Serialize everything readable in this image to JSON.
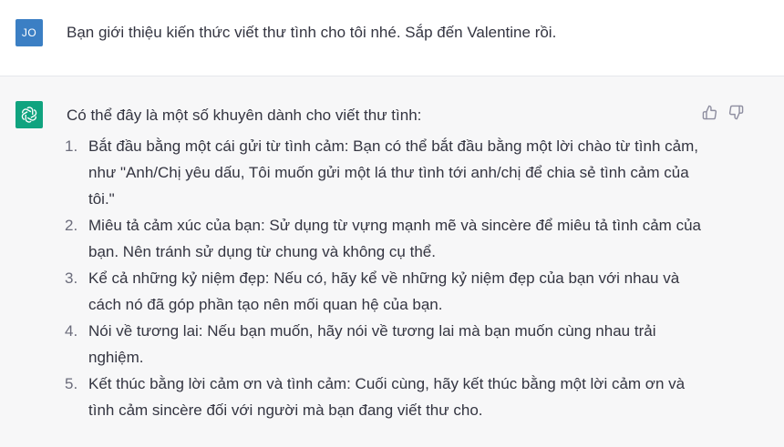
{
  "user": {
    "avatar_initials": "JO",
    "message": "Bạn giới thiệu kiến thức viết thư tình cho tôi nhé. Sắp đến Valentine rồi."
  },
  "assistant": {
    "intro": "Có thể đây là một số khuyên dành cho viết thư tình:",
    "feedback": {
      "thumbs_up_icon": "thumbs-up-icon",
      "thumbs_down_icon": "thumbs-down-icon"
    },
    "items": [
      {
        "number": "1.",
        "text": "Bắt đầu bằng một cái gửi từ tình cảm: Bạn có thể bắt đầu bằng một lời chào từ tình cảm, như \"Anh/Chị yêu dấu, Tôi muốn gửi một lá thư tình tới anh/chị để chia sẻ tình cảm của tôi.\""
      },
      {
        "number": "2.",
        "text": "Miêu tả cảm xúc của bạn: Sử dụng từ vựng mạnh mẽ và sincère để miêu tả tình cảm của bạn. Nên tránh sử dụng từ chung và không cụ thể."
      },
      {
        "number": "3.",
        "text": "Kể cả những kỷ niệm đẹp: Nếu có, hãy kể về những kỷ niệm đẹp của bạn với nhau và cách nó đã góp phần tạo nên mối quan hệ của bạn."
      },
      {
        "number": "4.",
        "text": "Nói về tương lai: Nếu bạn muốn, hãy nói về tương lai mà bạn muốn cùng nhau trải nghiệm."
      },
      {
        "number": "5.",
        "text": "Kết thúc bằng lời cảm ơn và tình cảm: Cuối cùng, hãy kết thúc bằng một lời cảm ơn và tình cảm sincère đối với người mà bạn đang viết thư cho."
      }
    ]
  },
  "colors": {
    "user_avatar_bg": "#3b7fc4",
    "bot_avatar_bg": "#10a37f",
    "assistant_bg": "#f7f7f8"
  }
}
